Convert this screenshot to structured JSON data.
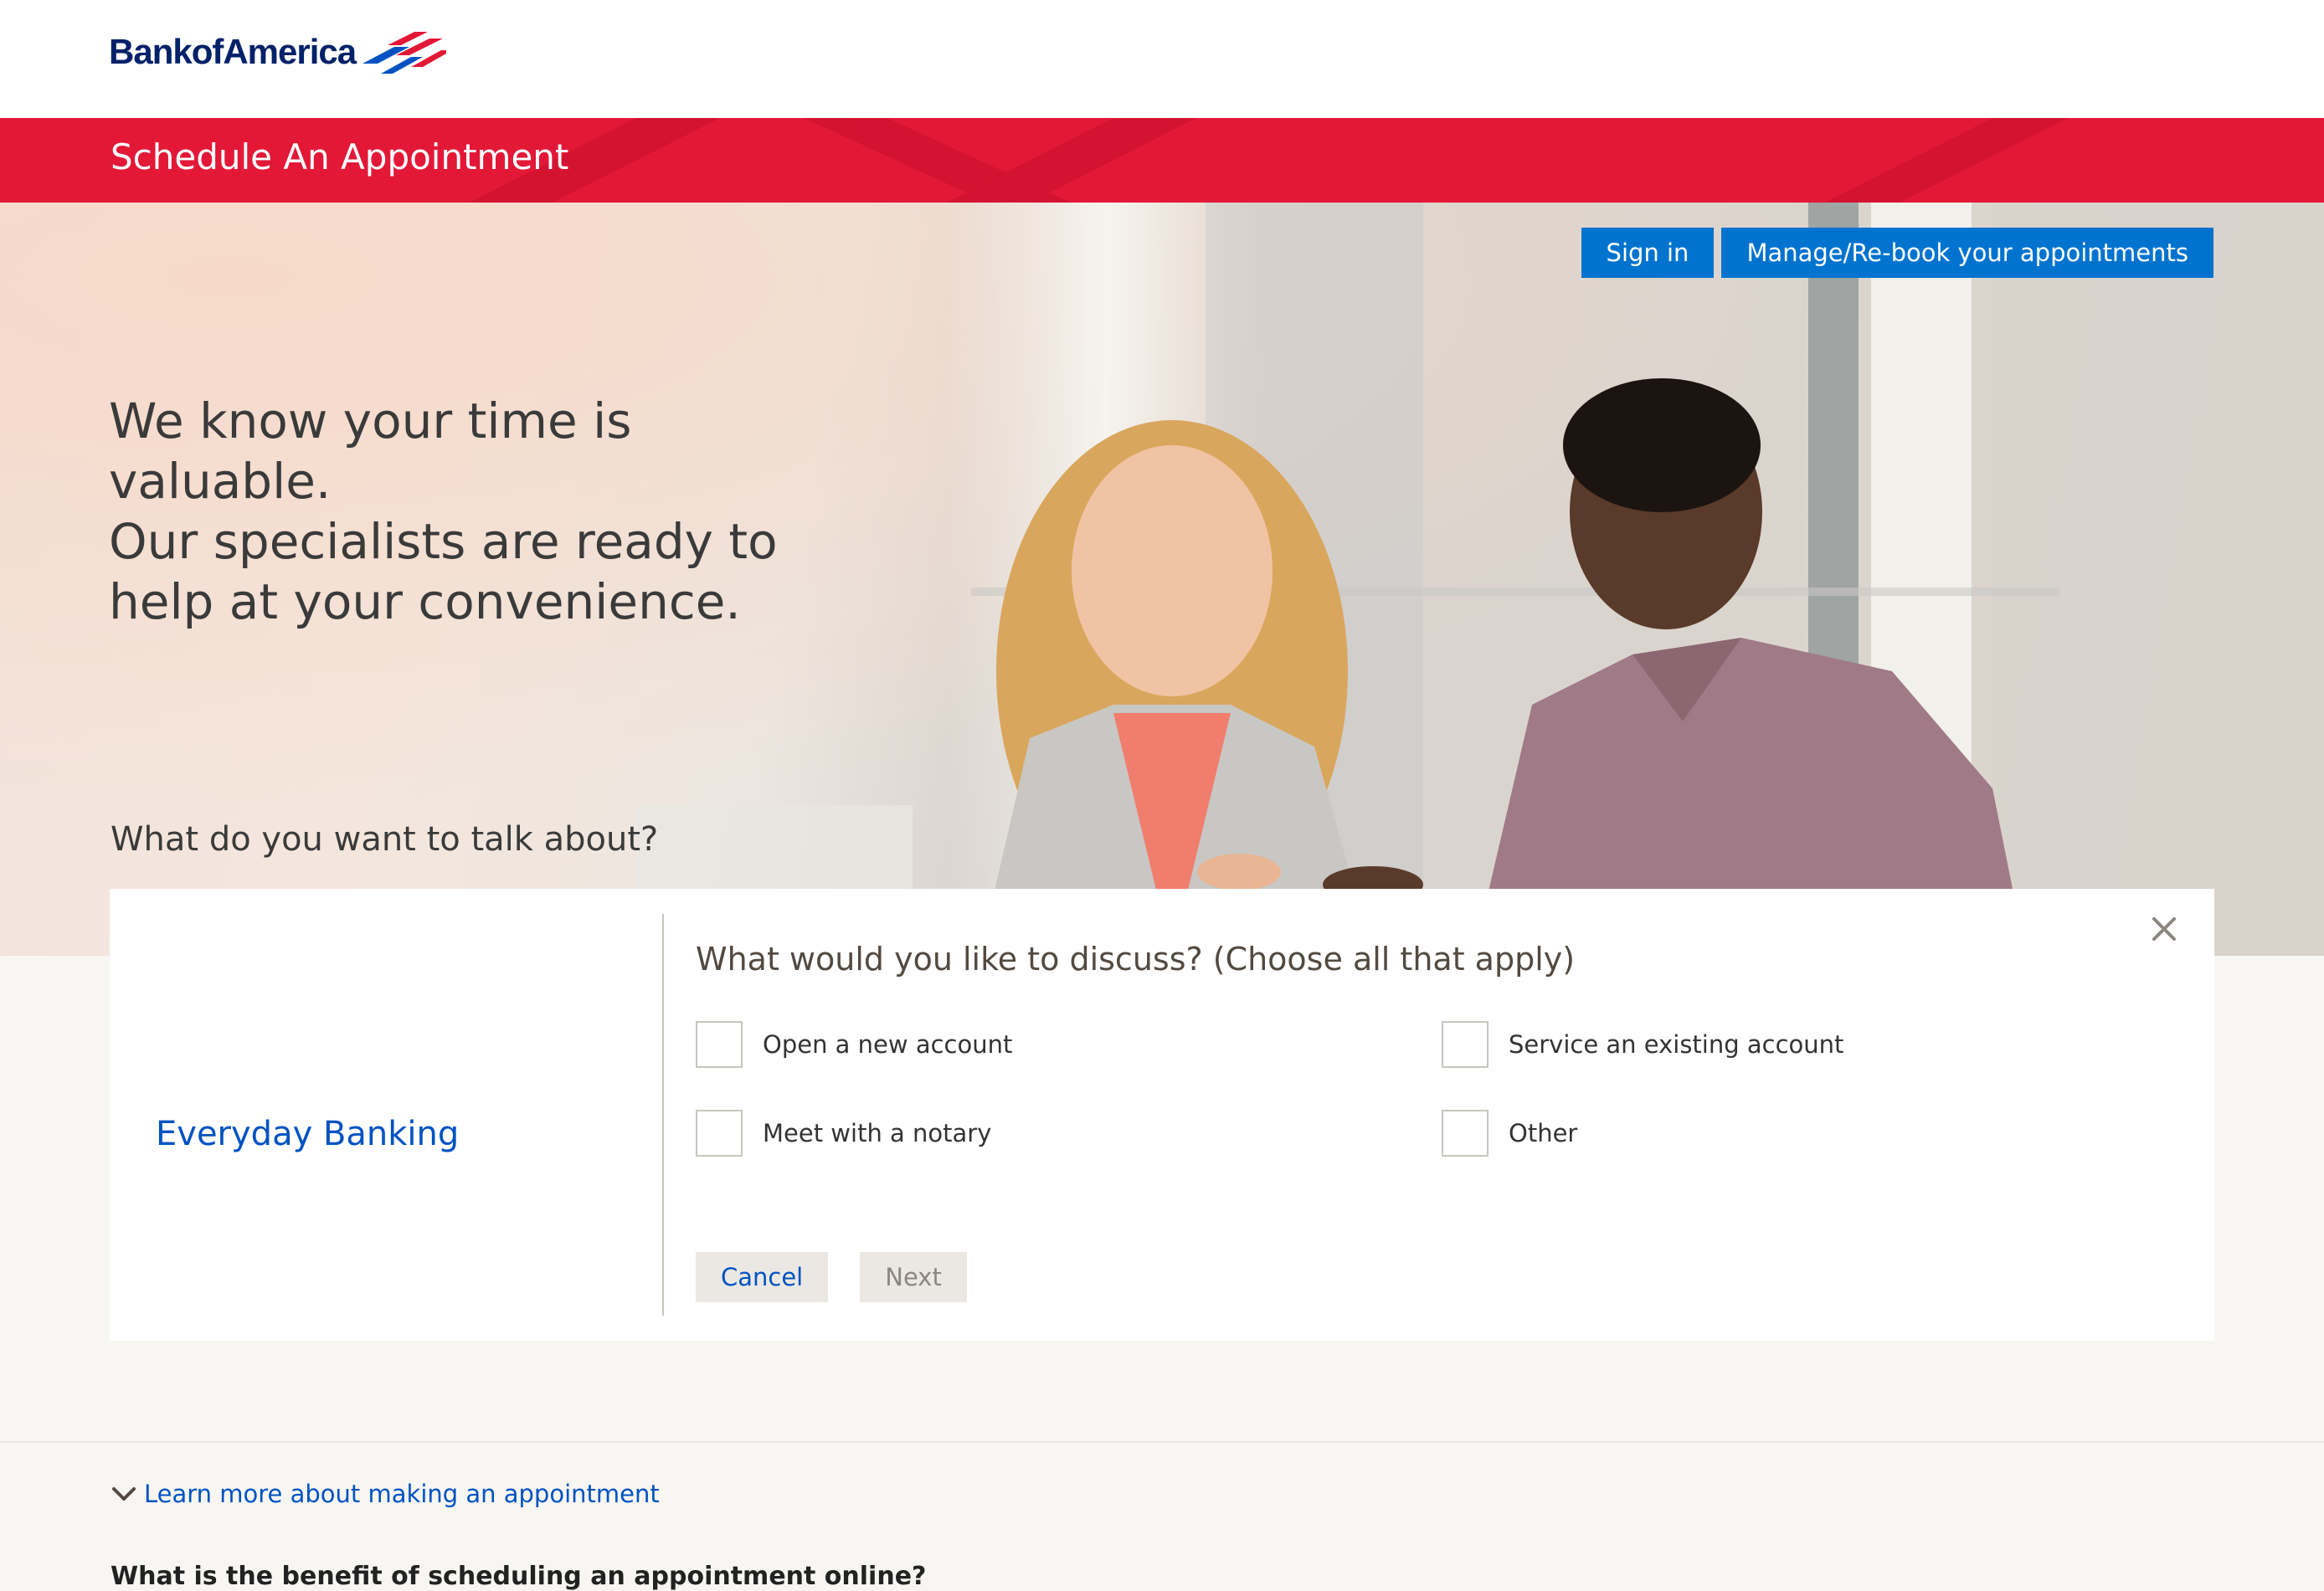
{
  "brand": {
    "name": "Bank of America",
    "logo_text": "BankofAmerica",
    "logo_color": "#012169",
    "flag_red": "#e31837",
    "flag_blue": "#0052c2"
  },
  "banner": {
    "title": "Schedule An Appointment",
    "color": "#e31837"
  },
  "hero": {
    "sign_in_label": "Sign in",
    "manage_label": "Manage/Re-book your appointments",
    "headline_lines": [
      "We know your time is valuable.",
      "Our specialists are ready to",
      "help at your convenience."
    ],
    "question": "What do you want to talk about?"
  },
  "panel": {
    "category": "Everyday Banking",
    "heading": "What would you like to discuss? (Choose all that apply)",
    "options": [
      {
        "label": "Open a new account",
        "checked": false
      },
      {
        "label": "Service an existing account",
        "checked": false
      },
      {
        "label": "Meet with a notary",
        "checked": false
      },
      {
        "label": "Other",
        "checked": false
      }
    ],
    "cancel_label": "Cancel",
    "next_label": "Next",
    "close_icon": "close-icon"
  },
  "footer": {
    "learn_more": "Learn more about making an appointment",
    "faq_question": "What is the benefit of scheduling an appointment online?"
  },
  "colors": {
    "primary_blue": "#0073cf",
    "link_blue": "#0052c2",
    "page_bg": "#f7f6f3",
    "secondary_btn_bg": "#ebe8e3"
  }
}
